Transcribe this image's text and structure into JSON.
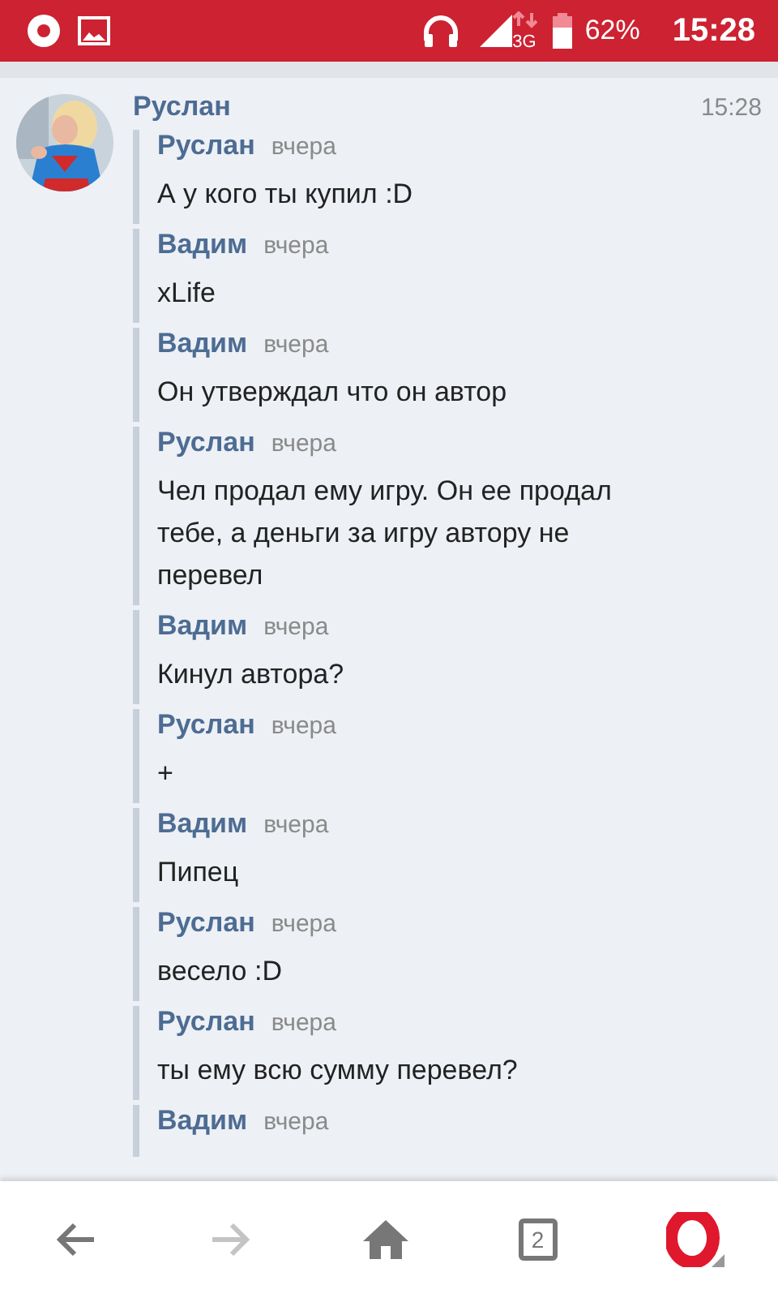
{
  "status_bar": {
    "network": "3G",
    "battery": "62%",
    "time": "15:28"
  },
  "post": {
    "author": "Руслан",
    "time": "15:28",
    "messages": [
      {
        "author": "Руслан",
        "time": "вчера",
        "text": "А у кого ты купил :D"
      },
      {
        "author": "Вадим",
        "time": "вчера",
        "text": "xLife"
      },
      {
        "author": "Вадим",
        "time": "вчера",
        "text": "Он утверждал что он автор"
      },
      {
        "author": "Руслан",
        "time": "вчера",
        "text": "Чел продал ему игру. Он ее продал тебе, а деньги за игру автору не перевел"
      },
      {
        "author": "Вадим",
        "time": "вчера",
        "text": "Кинул автора?"
      },
      {
        "author": "Руслан",
        "time": "вчера",
        "text": "+"
      },
      {
        "author": "Вадим",
        "time": "вчера",
        "text": "Пипец"
      },
      {
        "author": "Руслан",
        "time": "вчера",
        "text": "весело :D"
      },
      {
        "author": "Руслан",
        "time": "вчера",
        "text": "ты ему всю сумму перевел?"
      },
      {
        "author": "Вадим",
        "time": "вчера"
      }
    ]
  },
  "nav": [
    {
      "kind": "back",
      "disabled": false
    },
    {
      "kind": "forward",
      "disabled": true
    },
    {
      "kind": "home"
    },
    {
      "kind": "tabs",
      "count": "2"
    },
    {
      "kind": "menu"
    }
  ]
}
